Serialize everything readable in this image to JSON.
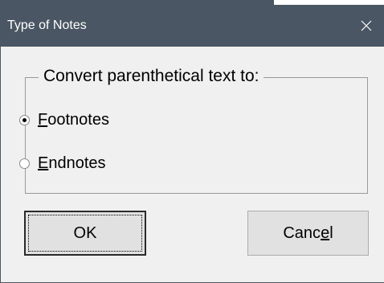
{
  "window": {
    "title": "Type of Notes"
  },
  "group": {
    "legend": "Convert parenthetical text to:",
    "options": [
      {
        "label_underlined": "F",
        "label_rest": "ootnotes",
        "checked": true
      },
      {
        "label_underlined": "E",
        "label_rest": "ndnotes",
        "checked": false
      }
    ]
  },
  "buttons": {
    "ok_label": "OK",
    "cancel_pre": "Canc",
    "cancel_underlined": "e",
    "cancel_post": "l"
  },
  "icons": {
    "close": "close-icon"
  },
  "colors": {
    "titlebar": "#4a5663",
    "dialog_bg": "#f0f0f0",
    "button_bg": "#e1e1e1"
  }
}
